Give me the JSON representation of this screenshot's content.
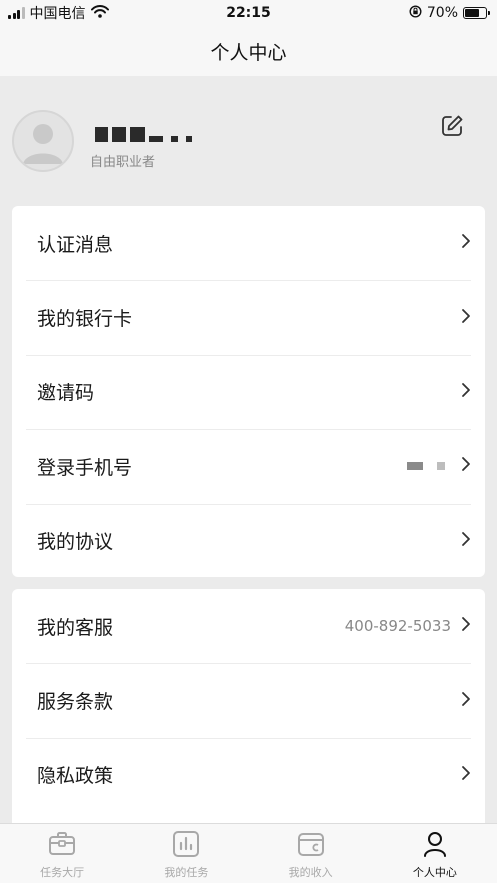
{
  "status_bar": {
    "carrier": "中国电信",
    "time": "22:15",
    "battery": "70%",
    "battery_level": 0.7,
    "icons": [
      "signal-icon",
      "wifi-icon",
      "orientation-lock-icon",
      "battery-icon"
    ]
  },
  "nav": {
    "title": "个人中心"
  },
  "profile": {
    "role": "自由职业者",
    "icons": [
      "avatar",
      "edit-icon"
    ]
  },
  "menu_group_1": [
    {
      "label": "认证消息"
    },
    {
      "label": "我的银行卡"
    },
    {
      "label": "邀请码"
    },
    {
      "label": "登录手机号"
    },
    {
      "label": "我的协议"
    }
  ],
  "menu_group_2": [
    {
      "label": "我的客服",
      "value": "400-892-5033"
    },
    {
      "label": "服务条款"
    },
    {
      "label": "隐私政策"
    }
  ],
  "tabs": [
    {
      "label": "任务大厅",
      "icon": "briefcase-icon",
      "active": false
    },
    {
      "label": "我的任务",
      "icon": "task-chart-icon",
      "active": false
    },
    {
      "label": "我的收入",
      "icon": "wallet-icon",
      "active": false
    },
    {
      "label": "个人中心",
      "icon": "person-icon",
      "active": true
    }
  ],
  "colors": {
    "background": "#ebebeb",
    "card": "#ffffff",
    "text_primary": "#1a1a1a",
    "text_secondary": "#888888",
    "tab_inactive": "#a8a8a8",
    "tab_active": "#111111"
  }
}
